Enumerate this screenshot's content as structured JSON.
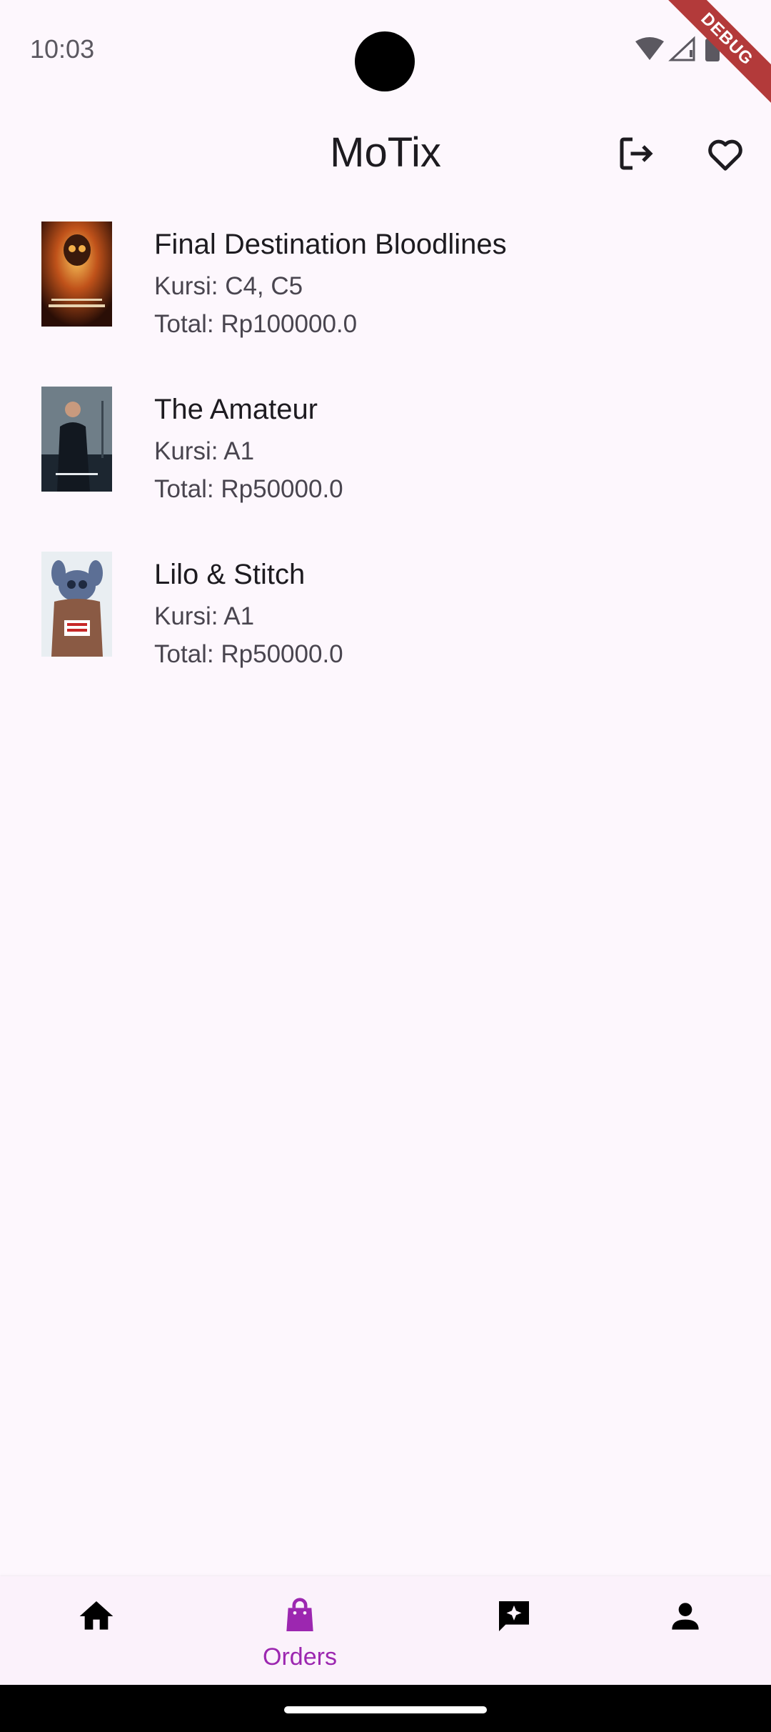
{
  "status_bar": {
    "time": "10:03",
    "debug_label": "DEBUG"
  },
  "app_bar": {
    "title": "MoTix"
  },
  "orders": [
    {
      "title": "Final Destination Bloodlines",
      "seats": "Kursi: C4, C5",
      "total": "Total: Rp100000.0",
      "poster_lines": [
        "FINAL",
        "DESTINATION"
      ]
    },
    {
      "title": "The Amateur",
      "seats": "Kursi: A1",
      "total": "Total: Rp50000.0",
      "poster_lines": [
        "AMATEUR"
      ]
    },
    {
      "title": "Lilo & Stitch",
      "seats": "Kursi: A1",
      "total": "Total: Rp50000.0",
      "poster_lines": [
        "LILO&",
        "STITCH"
      ]
    }
  ],
  "bottom_nav": {
    "items": [
      {
        "icon": "home-icon",
        "label": ""
      },
      {
        "icon": "shopping-bag-icon",
        "label": "Orders"
      },
      {
        "icon": "review-icon",
        "label": ""
      },
      {
        "icon": "person-icon",
        "label": ""
      }
    ],
    "active_index": 1
  },
  "colors": {
    "accent": "#9c27b0",
    "background": "#fdf7fd",
    "nav_background": "#fbf2fb",
    "debug_banner": "#b33a3a"
  }
}
